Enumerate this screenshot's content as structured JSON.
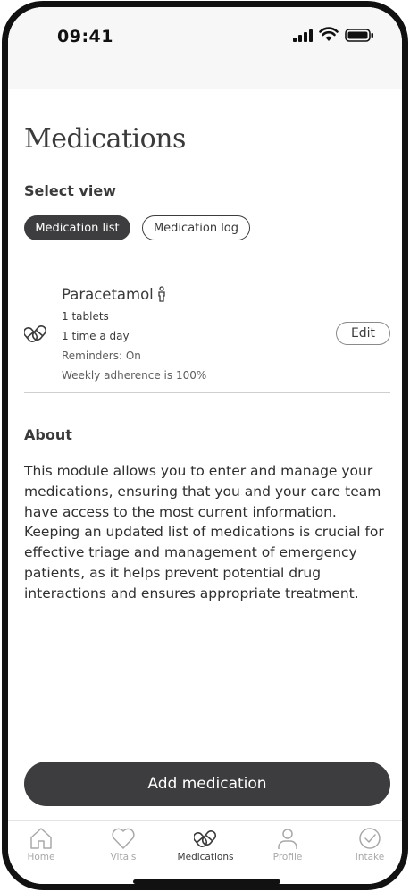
{
  "status_bar": {
    "time": "09:41"
  },
  "page": {
    "title": "Medications",
    "select_view_label": "Select view"
  },
  "view_tabs": {
    "active": "Medication list",
    "inactive": "Medication log"
  },
  "medication": {
    "name": "Paracetamol",
    "dose": "1 tablets",
    "frequency": "1 time a day",
    "reminders": "Reminders: On",
    "adherence": "Weekly adherence is 100%",
    "edit_label": "Edit"
  },
  "about": {
    "title": "About",
    "text": "This module allows you to enter and manage your medications, ensuring that you and your care team have access to the most current information. Keeping an updated list of medications is crucial for effective triage and management of emergency patients, as it helps prevent potential drug interactions and ensures appropriate treatment."
  },
  "add_button_label": "Add medication",
  "tab_bar": {
    "items": [
      {
        "label": "Home",
        "icon": "home-icon"
      },
      {
        "label": "Vitals",
        "icon": "heart-icon"
      },
      {
        "label": "Medications",
        "icon": "pills-icon"
      },
      {
        "label": "Profile",
        "icon": "person-icon"
      },
      {
        "label": "Intake",
        "icon": "check-circle-icon"
      }
    ],
    "active_index": 2
  },
  "colors": {
    "dark": "#3d3d3f",
    "inactive_tab": "#a8a8a8",
    "divider": "#cfcfcf"
  }
}
